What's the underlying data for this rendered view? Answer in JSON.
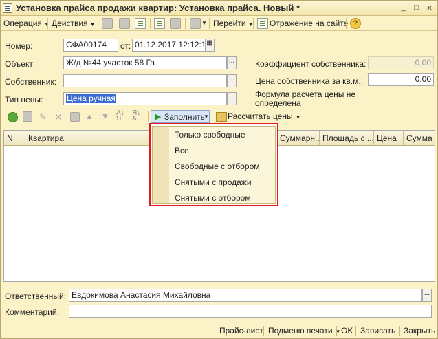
{
  "window": {
    "title": "Установка прайса продажи квартир: Установка прайса. Новый *",
    "controls": {
      "minimize": "_",
      "maximize": "□",
      "close": "×"
    }
  },
  "commandbar": {
    "operation": "Операция",
    "actions": "Действия",
    "goto": "Перейти",
    "reflection": "Отражение на сайте",
    "help": "?"
  },
  "form": {
    "number_label": "Номер:",
    "number_value": "СФА00174",
    "from_label": "от:",
    "date_value": "01.12.2017 12:12:15",
    "object_label": "Объект:",
    "object_value": "Ж/д №44 участок 58 Га",
    "owner_label": "Собственник:",
    "owner_value": "",
    "price_type_label": "Тип цены:",
    "price_type_value": "Цена ручная",
    "owner_coef_label": "Коэффициент собственника:",
    "owner_coef_value": "0,00",
    "owner_price_label": "Цена собственника за кв.м.:",
    "owner_price_value": "0,00",
    "formula_line1": "Формула расчета цены не",
    "formula_line2": "определена",
    "select_btn": "..."
  },
  "table_toolbar": {
    "fill": "Заполнить",
    "calculate": "Рассчитать цены"
  },
  "table": {
    "columns": [
      "N",
      "Квартира",
      "Суммарн...",
      "Площадь с ...",
      "Цена",
      "Сумма"
    ]
  },
  "fill_menu": {
    "items": [
      "Только свободные",
      "Все",
      "Свободные с отбором",
      "Снятыми с продажи",
      "Снятыми с отбором"
    ]
  },
  "footer": {
    "responsible_label": "Ответственный:",
    "responsible_value": "Евдокимова Анастасия Михайловна",
    "comment_label": "Комментарий:",
    "comment_value": ""
  },
  "bottombar": {
    "pricelist": "Прайс-лист",
    "print_submenu": "Подменю печати",
    "ok": "OK",
    "save": "Записать",
    "close": "Закрыть"
  },
  "colors": {
    "background": "#fbf2c8",
    "highlight_frame": "#e31b1b",
    "selection": "#3d6cd0"
  }
}
